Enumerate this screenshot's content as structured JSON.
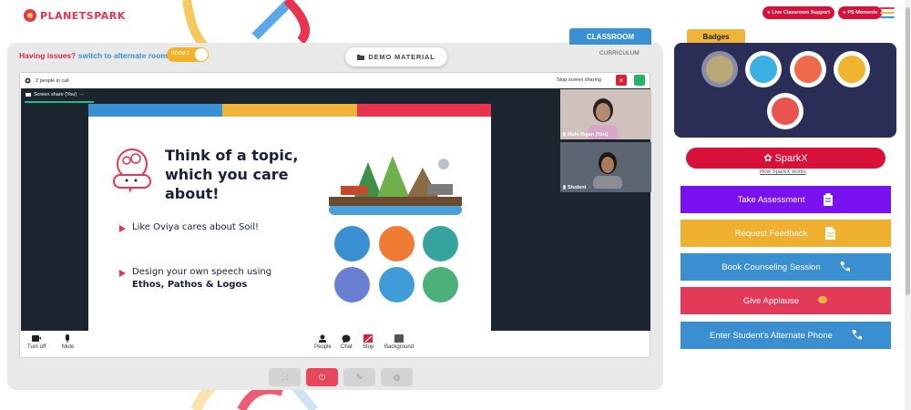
{
  "brand": {
    "logo_text": "PLANETSPARK"
  },
  "header": {
    "live_support_label": "Live Classroom Support",
    "ps_moments_label": "PS Moments",
    "menu_colors": [
      "#e8344e",
      "#f1b43a",
      "#3a90d4"
    ]
  },
  "room": {
    "issues_text": "Having issues?",
    "alternate_text": "switch to alternate room",
    "toggle_label": "ROOM 2",
    "demo_material_label": "DEMO MATERIAL",
    "classroom_tab": "CLASSROOM",
    "curriculum_label": "CURRICULUM"
  },
  "meeting": {
    "people_in_call": "2 people in call",
    "stop_screen_sharing": "Stop screen sharing",
    "close_glyph": "×",
    "screen_share_label": "Screen share (You)",
    "more_glyph": "···",
    "participants": [
      {
        "name": "Mahi Rajan (You)"
      },
      {
        "name": "Student"
      }
    ],
    "toolbar": {
      "turn_off": "Turn off",
      "mute": "Mute",
      "people": "People",
      "chat": "Chat",
      "stop": "Stop",
      "background": "Background"
    }
  },
  "slide": {
    "title": "Think of a topic, which you care about!",
    "bullet1": "Like Oviya cares about Soil!",
    "bullet2_line1": "Design your own speech using",
    "bullet2_bold": "Ethos, Pathos & Logos",
    "bar_colors": [
      "#3a90d4",
      "#f1b43a",
      "#e8344e"
    ]
  },
  "bottom_controls": [
    "fullscreen-icon",
    "power-icon",
    "pencil-icon",
    "palette-icon"
  ],
  "badges": {
    "tab_label": "Badges",
    "items": [
      "trophy-badge-icon",
      "person-badge-icon",
      "yoga-badge-icon",
      "idea-badge-icon",
      "robot-badge-icon"
    ]
  },
  "sparkx": {
    "label": "SparkX",
    "link": "How SparkX works"
  },
  "actions": [
    {
      "label": "Take Assessment",
      "color": "#7a12ef",
      "icon": "clipboard-icon"
    },
    {
      "label": "Request Feedback",
      "color": "#f0b02f",
      "icon": "document-icon"
    },
    {
      "label": "Book Counseling Session",
      "color": "#3a8fd0",
      "icon": "phone-icon"
    },
    {
      "label": "Give Applause",
      "color": "#e33a5a",
      "icon": "clap-icon"
    },
    {
      "label": "Enter Student's Alternate Phone",
      "color": "#3a8fd0",
      "icon": "phone-icon"
    }
  ]
}
